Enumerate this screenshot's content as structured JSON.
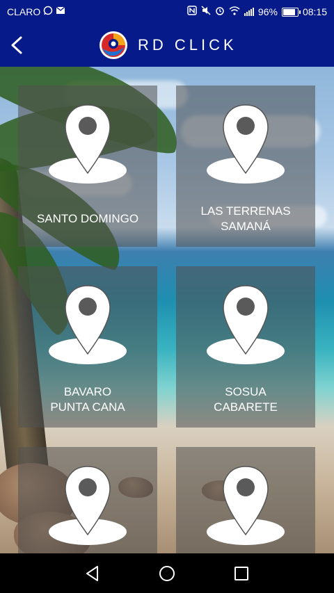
{
  "status_bar": {
    "carrier": "CLARO",
    "battery": "96%",
    "battery_level": 0.96,
    "time": "08:15",
    "left_icons": [
      "whatsapp-icon",
      "mail-icon"
    ],
    "right_icons": [
      "nfc-icon",
      "mute-icon",
      "alarm-icon",
      "wifi-icon",
      "signal-icon",
      "battery-icon"
    ]
  },
  "app_bar": {
    "title": "RD CLICK",
    "back_icon": "back-arrow-icon"
  },
  "tiles": [
    {
      "label": "SANTO DOMINGO"
    },
    {
      "label": "LAS TERRENAS\nSAMANÁ"
    },
    {
      "label": "BAVARO\nPUNTA CANA"
    },
    {
      "label": "SOSUA\nCABARETE"
    },
    {
      "label": ""
    },
    {
      "label": ""
    }
  ],
  "nav_bar": {
    "icons": [
      "nav-back-icon",
      "nav-home-icon",
      "nav-recents-icon"
    ]
  },
  "colors": {
    "bar_background": "#061a8a",
    "tile_overlay": "rgba(80,80,80,0.55)",
    "text": "#ffffff"
  }
}
